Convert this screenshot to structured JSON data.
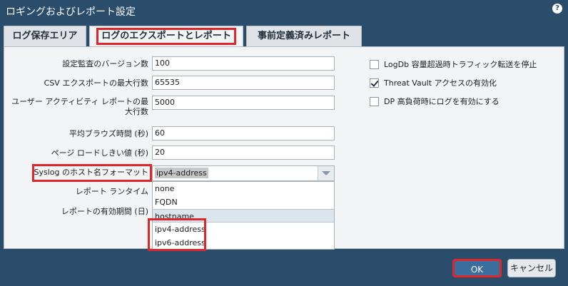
{
  "window": {
    "title": "ロギングおよびレポート設定",
    "help_icon": "help-icon"
  },
  "tabs": [
    {
      "label": "ログ保存エリア",
      "active": false
    },
    {
      "label": "ログのエクスポートとレポート",
      "active": true
    },
    {
      "label": "事前定義済みレポート",
      "active": false
    }
  ],
  "form": {
    "audit_version_label": "設定監査のバージョン数",
    "audit_version_value": "100",
    "csv_max_rows_label": "CSV エクスポートの最大行数",
    "csv_max_rows_value": "65535",
    "user_activity_label_line1": "ユーザー アクティビティ レポートの最",
    "user_activity_label_line2": "大行数",
    "user_activity_value": "5000",
    "avg_browse_label": "平均ブラウズ時間 (秒)",
    "avg_browse_value": "60",
    "page_load_label": "ページ ロードしきい値 (秒)",
    "page_load_value": "20",
    "syslog_label": "Syslog のホスト名フォーマット",
    "syslog_value": "ipv4-address",
    "report_runtime_label": "レポート ランタイム",
    "report_expiry_label": "レポートの有効期間 (日)"
  },
  "dropdown": {
    "options": [
      "none",
      "FQDN",
      "hostname",
      "ipv4-address",
      "ipv6-address"
    ],
    "highlighted": "hostname"
  },
  "checkboxes": [
    {
      "label": "LogDb 容量超過時トラフィック転送を停止",
      "checked": false
    },
    {
      "label": "Threat Vault アクセスの有効化",
      "checked": true
    },
    {
      "label": "DP 高負荷時にログを有効にする",
      "checked": false
    }
  ],
  "buttons": {
    "ok": "OK",
    "cancel": "キャンセル"
  },
  "colors": {
    "title_bar": "#2b4d6c",
    "highlight_box": "#e0262b",
    "ok_button": "#3a6e9c"
  }
}
